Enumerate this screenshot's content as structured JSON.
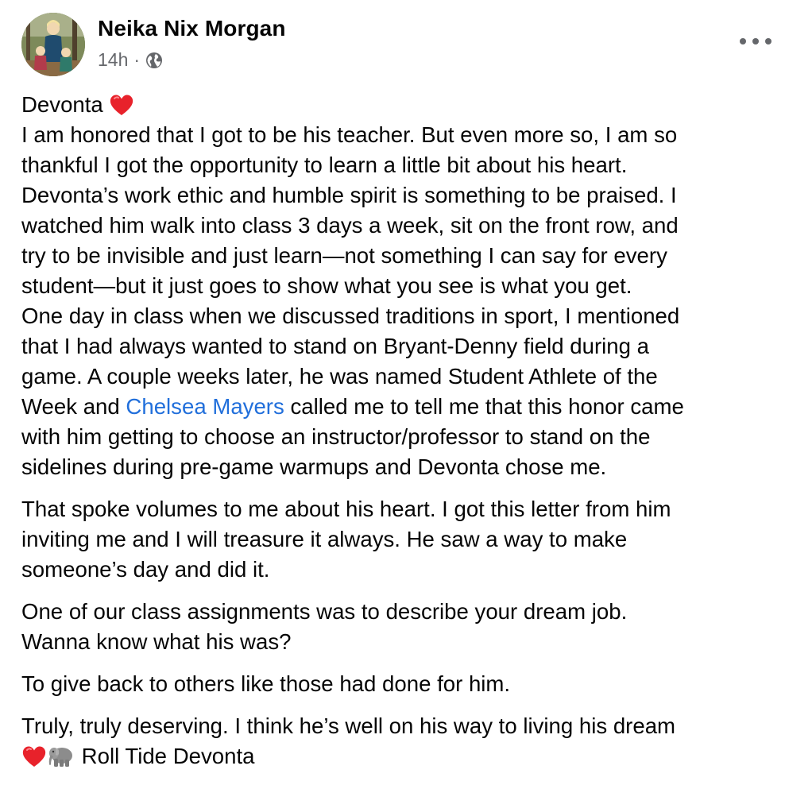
{
  "post": {
    "author_name": "Neika Nix Morgan",
    "timestamp": "14h",
    "separator": "·",
    "privacy_icon": "globe-icon",
    "more_icon": "more-options-icon",
    "heart_color": "#e8222b",
    "mention_color": "#216fdb",
    "body": {
      "p1": {
        "title": "Devonta",
        "title_emoji": "red-heart",
        "lines": {
          "l1": "I am honored that I got to be his teacher. But even more so, I am so",
          "l2": "thankful I got the opportunity to learn a little bit about his heart.",
          "l3": "Devonta’s work ethic and humble spirit is something to be praised. I",
          "l4": "watched him walk into class 3 days a week, sit on the front row, and",
          "l5": "try to be invisible and just learn—not something I can say for every",
          "l6": "student—but it just goes to show what you see is what you get.",
          "l7": "One day in class when we discussed traditions in sport, I mentioned",
          "l8": "that I had always wanted to stand on Bryant-Denny field during a",
          "l9": "game. A couple weeks later, he was named Student Athlete of the",
          "l10_before": "Week and",
          "l10_mention": "Chelsea Mayers",
          "l10_after": "called me to tell me that this honor came",
          "l11": "with him getting to choose an instructor/professor to stand on the",
          "l12": "sidelines during pre-game warmups and Devonta chose me."
        }
      },
      "p2": {
        "l1": "That spoke volumes to me about his heart. I got this letter from him",
        "l2": "inviting me and I will treasure it always. He saw a way to make",
        "l3": "someone’s day and did it."
      },
      "p3": {
        "l1": "One of our class assignments was to describe your dream job.",
        "l2": "Wanna know what his was?"
      },
      "p4": {
        "l1": "To give back to others like those had done for him."
      },
      "p5": {
        "l1": "Truly, truly deserving. I think he’s well on his way to living his dream",
        "l2_emojis": [
          "red-heart",
          "elephant"
        ],
        "l2_text": "Roll Tide Devonta"
      }
    }
  }
}
